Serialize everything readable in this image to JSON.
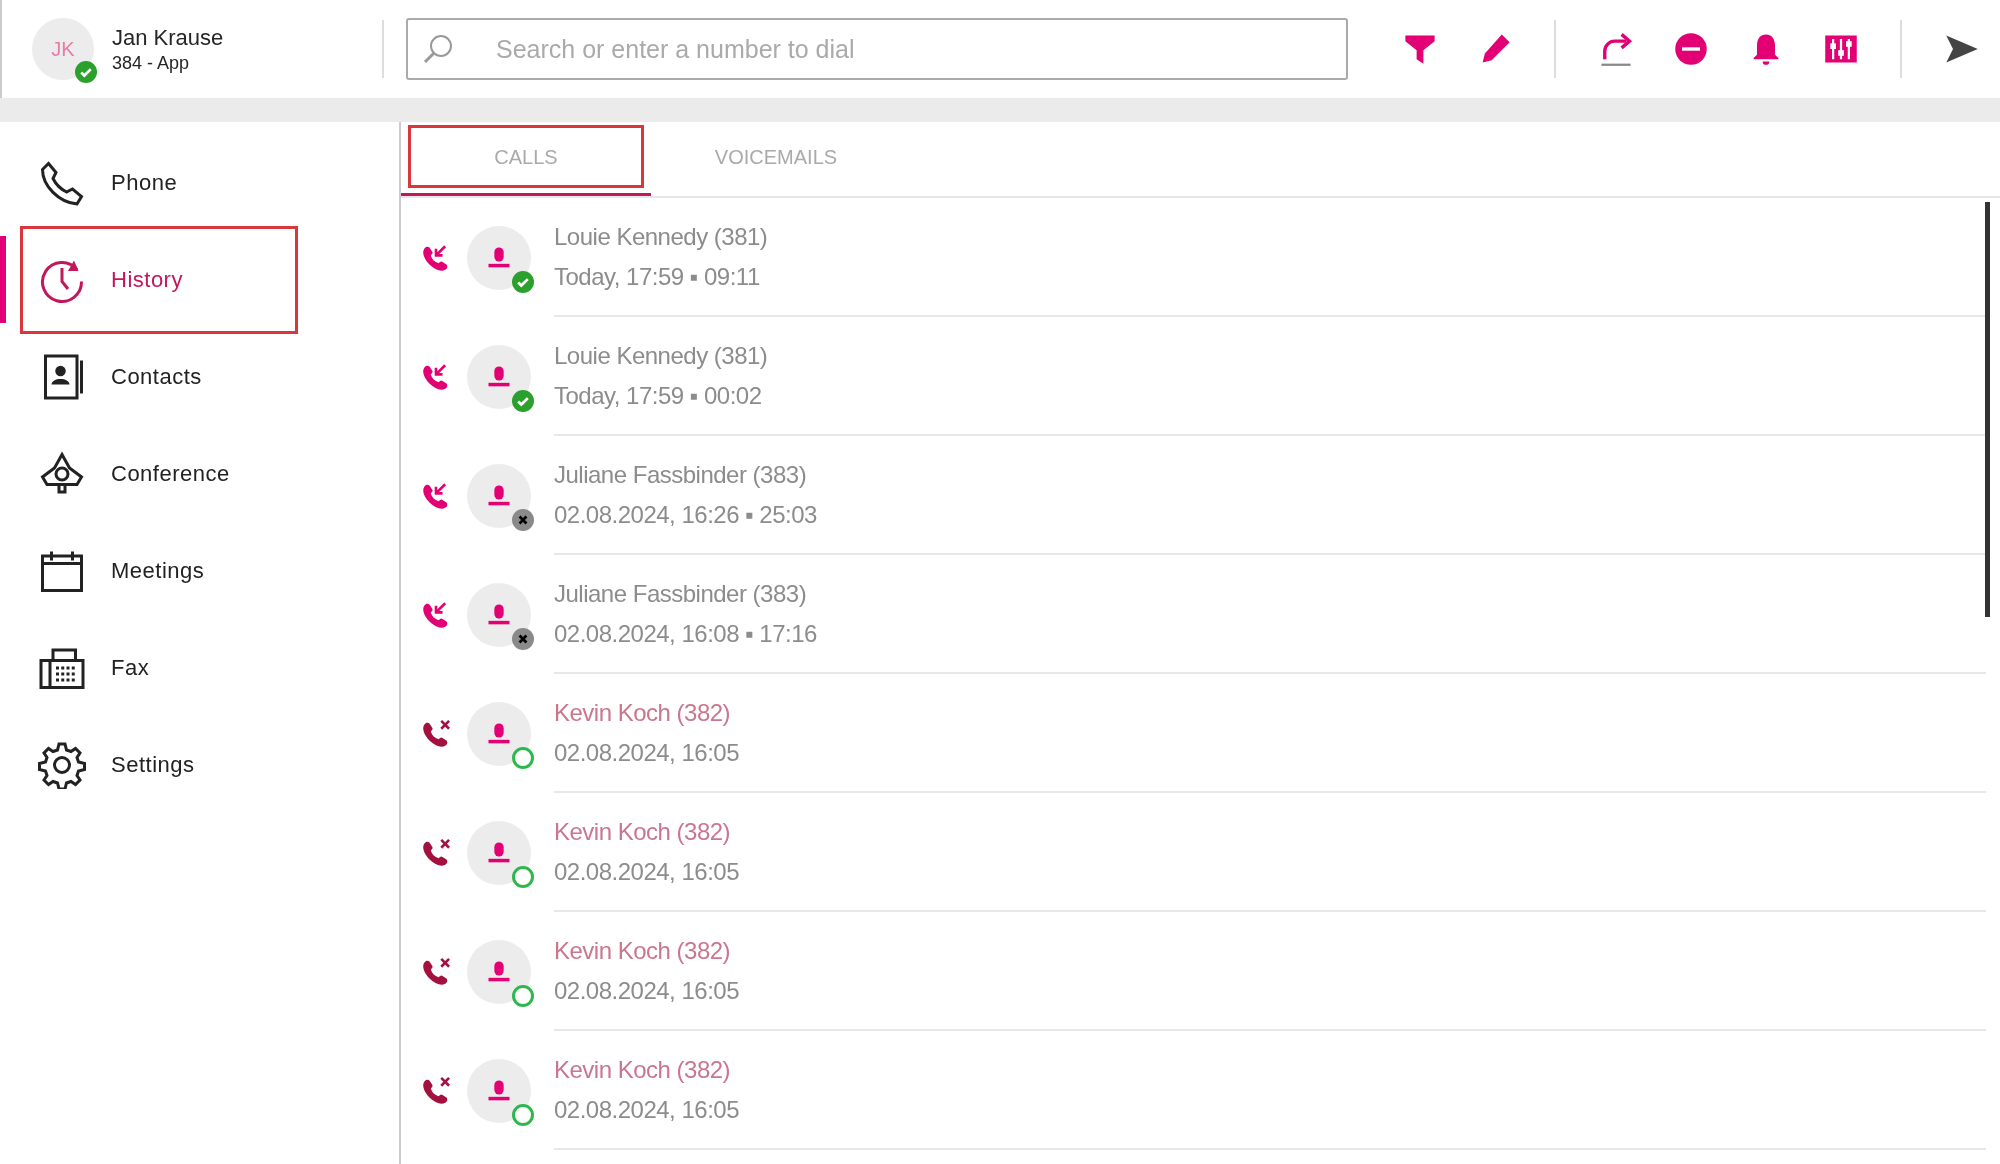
{
  "user": {
    "initials": "JK",
    "name": "Jan Krause",
    "line": "384 - App",
    "available": true,
    "offline": false
  },
  "search": {
    "placeholder": "Search or enter a number to dial"
  },
  "toolbar": [
    {
      "kind": "filter"
    },
    {
      "kind": "edit"
    },
    {
      "kind": "separator"
    },
    {
      "kind": "forward"
    },
    {
      "kind": "dnd"
    },
    {
      "kind": "bell"
    },
    {
      "kind": "mixer"
    },
    {
      "kind": "separator"
    },
    {
      "kind": "send"
    }
  ],
  "sidebar": {
    "items": [
      {
        "kind": "phone",
        "label": "Phone",
        "selected": false,
        "highlighted": false
      },
      {
        "kind": "history",
        "label": "History",
        "selected": true,
        "highlighted": true
      },
      {
        "kind": "contacts",
        "label": "Contacts",
        "selected": false,
        "highlighted": false
      },
      {
        "kind": "conference",
        "label": "Conference",
        "selected": false,
        "highlighted": false
      },
      {
        "kind": "meetings",
        "label": "Meetings",
        "selected": false,
        "highlighted": false
      },
      {
        "kind": "fax",
        "label": "Fax",
        "selected": false,
        "highlighted": false
      },
      {
        "kind": "settings",
        "label": "Settings",
        "selected": false,
        "highlighted": false
      }
    ]
  },
  "tabs": [
    {
      "label": "CALLS",
      "selected": true,
      "highlighted": true
    },
    {
      "label": "VOICEMAILS",
      "selected": false,
      "highlighted": false
    }
  ],
  "calls": [
    {
      "kind": "incoming",
      "available": true,
      "offline": false,
      "name": "Louie Kennedy (381)",
      "detail": "Today, 17:59 ▪ 09:11"
    },
    {
      "kind": "incoming",
      "available": true,
      "offline": false,
      "name": "Louie Kennedy (381)",
      "detail": "Today, 17:59 ▪ 00:02"
    },
    {
      "kind": "incoming",
      "available": false,
      "offline": true,
      "name": "Juliane Fassbinder (383)",
      "detail": "02.08.2024, 16:26 ▪ 25:03"
    },
    {
      "kind": "incoming",
      "available": false,
      "offline": true,
      "name": "Juliane Fassbinder (383)",
      "detail": "02.08.2024, 16:08 ▪ 17:16"
    },
    {
      "kind": "missed",
      "available": false,
      "offline": false,
      "name": "Kevin Koch (382)",
      "detail": "02.08.2024, 16:05"
    },
    {
      "kind": "missed",
      "available": false,
      "offline": false,
      "name": "Kevin Koch (382)",
      "detail": "02.08.2024, 16:05"
    },
    {
      "kind": "missed",
      "available": false,
      "offline": false,
      "name": "Kevin Koch (382)",
      "detail": "02.08.2024, 16:05"
    },
    {
      "kind": "missed",
      "available": false,
      "offline": false,
      "name": "Kevin Koch (382)",
      "detail": "02.08.2024, 16:05"
    }
  ]
}
